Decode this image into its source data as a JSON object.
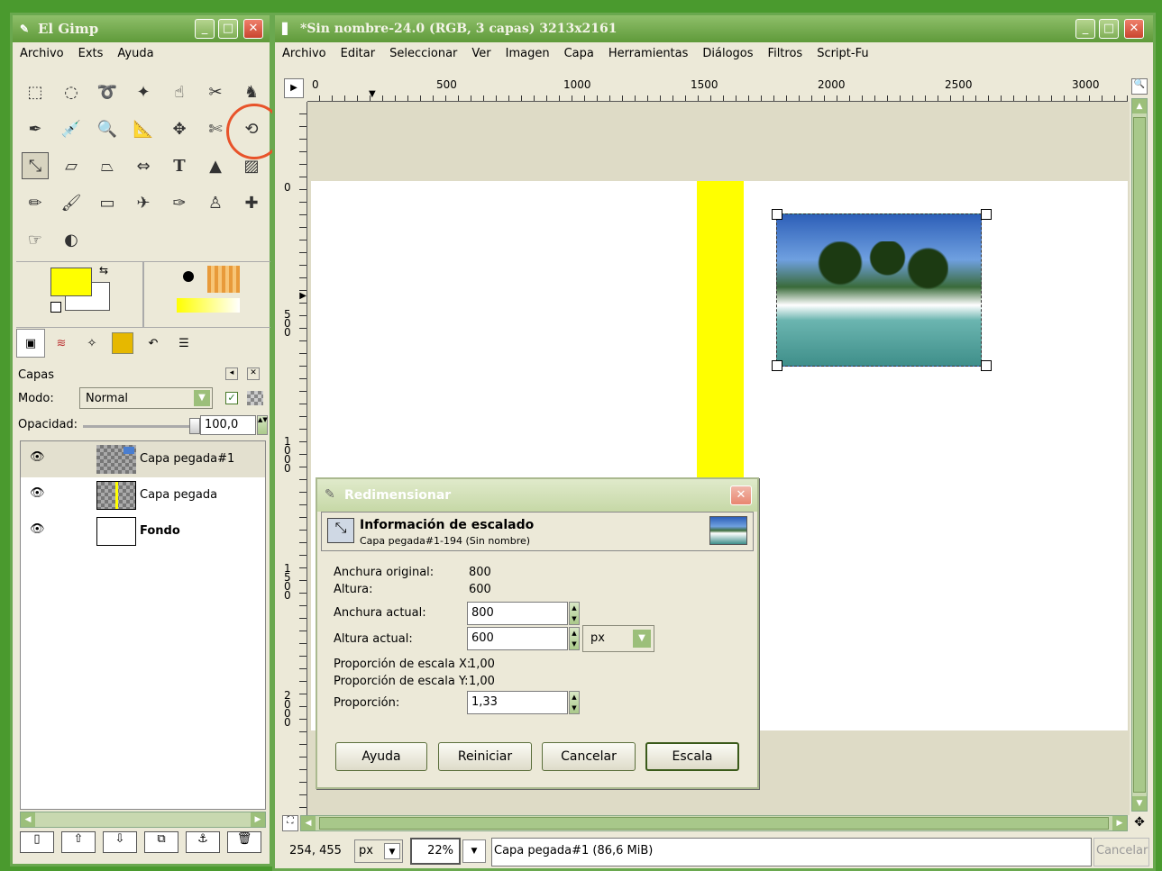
{
  "toolbox": {
    "title": "El Gimp",
    "menu": [
      "Archivo",
      "Exts",
      "Ayuda"
    ],
    "tools": [
      "rect-select-icon",
      "ellipse-select-icon",
      "lasso-icon",
      "fuzzy-select-icon",
      "color-select-icon",
      "scissors-icon",
      "foreground-select-icon",
      "paths-icon",
      "color-picker-icon",
      "zoom-icon",
      "measure-icon",
      "move-icon",
      "crop-icon",
      "rotate-icon",
      "scale-icon",
      "shear-icon",
      "perspective-icon",
      "flip-icon",
      "text-icon",
      "bucket-fill-icon",
      "blend-icon",
      "pencil-icon",
      "paintbrush-icon",
      "eraser-icon",
      "airbrush-icon",
      "ink-icon",
      "clone-icon",
      "heal-icon",
      "smudge-icon",
      "dodge-burn-icon"
    ],
    "fg_color": "#ffff00",
    "bg_color": "#ffffff"
  },
  "layers_panel": {
    "title": "Capas",
    "mode_label": "Modo:",
    "mode_value": "Normal",
    "opacity_label": "Opacidad:",
    "opacity_value": "100,0",
    "opacity_fraction": 1.0,
    "layers": [
      {
        "name": "Capa pegada#1",
        "bold": false,
        "selected": true
      },
      {
        "name": "Capa pegada",
        "bold": false,
        "selected": false
      },
      {
        "name": "Fondo",
        "bold": true,
        "selected": false
      }
    ]
  },
  "image_window": {
    "title": "*Sin nombre-24.0 (RGB, 3 capas) 3213x2161",
    "menu": [
      "Archivo",
      "Editar",
      "Seleccionar",
      "Ver",
      "Imagen",
      "Capa",
      "Herramientas",
      "Diálogos",
      "Filtros",
      "Script-Fu"
    ],
    "ruler_h_labels": [
      "0",
      "500",
      "1000",
      "1500",
      "2000",
      "2500",
      "3000"
    ],
    "ruler_v_labels": [
      "0",
      "500",
      "1000",
      "1500",
      "2000"
    ],
    "status": {
      "coords": "254, 455",
      "unit": "px",
      "zoom": "22%",
      "message": "Capa pegada#1 (86,6 MiB)",
      "cancel": "Cancelar"
    }
  },
  "dialog": {
    "title": "Redimensionar",
    "header": "Información de escalado",
    "subheader": "Capa pegada#1-194 (Sin nombre)",
    "rows": {
      "orig_width_label": "Anchura original:",
      "orig_width": "800",
      "height_label": "Altura:",
      "height": "600",
      "cur_width_label": "Anchura actual:",
      "cur_width": "800",
      "cur_height_label": "Altura actual:",
      "cur_height": "600",
      "unit": "px",
      "scale_x_label": "Proporción de escala X:",
      "scale_x": "1,00",
      "scale_y_label": "Proporción de escala Y:",
      "scale_y": "1,00",
      "ratio_label": "Proporción:",
      "ratio": "1,33"
    },
    "buttons": {
      "help": "Ayuda",
      "reset": "Reiniciar",
      "cancel": "Cancelar",
      "scale": "Escala"
    }
  }
}
